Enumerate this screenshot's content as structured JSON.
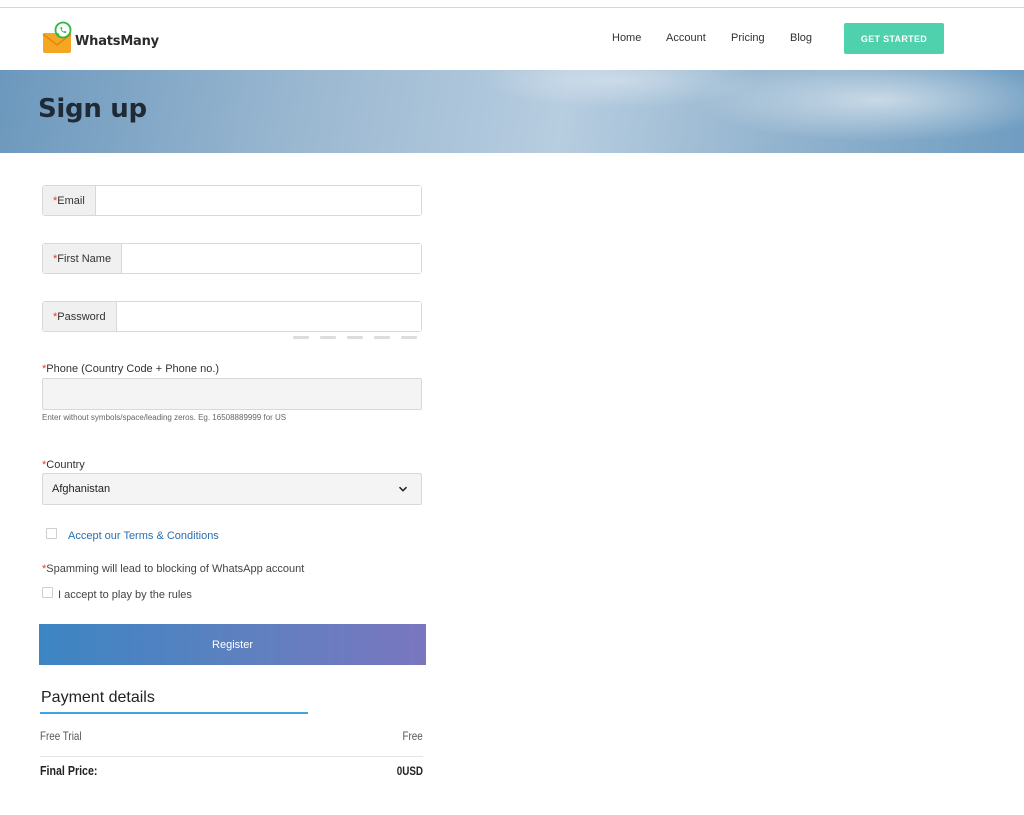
{
  "header": {
    "logo_text": "WhatsMany",
    "nav": [
      "Home",
      "Account",
      "Pricing",
      "Blog"
    ],
    "cta_label": "GET STARTED",
    "colors": {
      "cta": "#4fd1ad"
    }
  },
  "hero": {
    "title": "Sign up"
  },
  "form": {
    "required_mark": "*",
    "email_label": "Email",
    "first_name_label": "First Name",
    "password_label": "Password",
    "phone_label": "Phone (Country Code + Phone no.)",
    "phone_hint": "Enter without symbols/space/leading zeros. Eg. 16508889999 for US",
    "country_label": "Country",
    "country_value": "Afghanistan",
    "terms_label": "Accept our Terms & Conditions",
    "spam_warning": "Spamming will lead to blocking of WhatsApp account",
    "rules_label": "I accept to play by the rules",
    "register_label": "Register"
  },
  "payment": {
    "title": "Payment details",
    "trial_label": "Free Trial",
    "trial_value": "Free",
    "final_label": "Final Price:",
    "final_value": "0USD"
  }
}
